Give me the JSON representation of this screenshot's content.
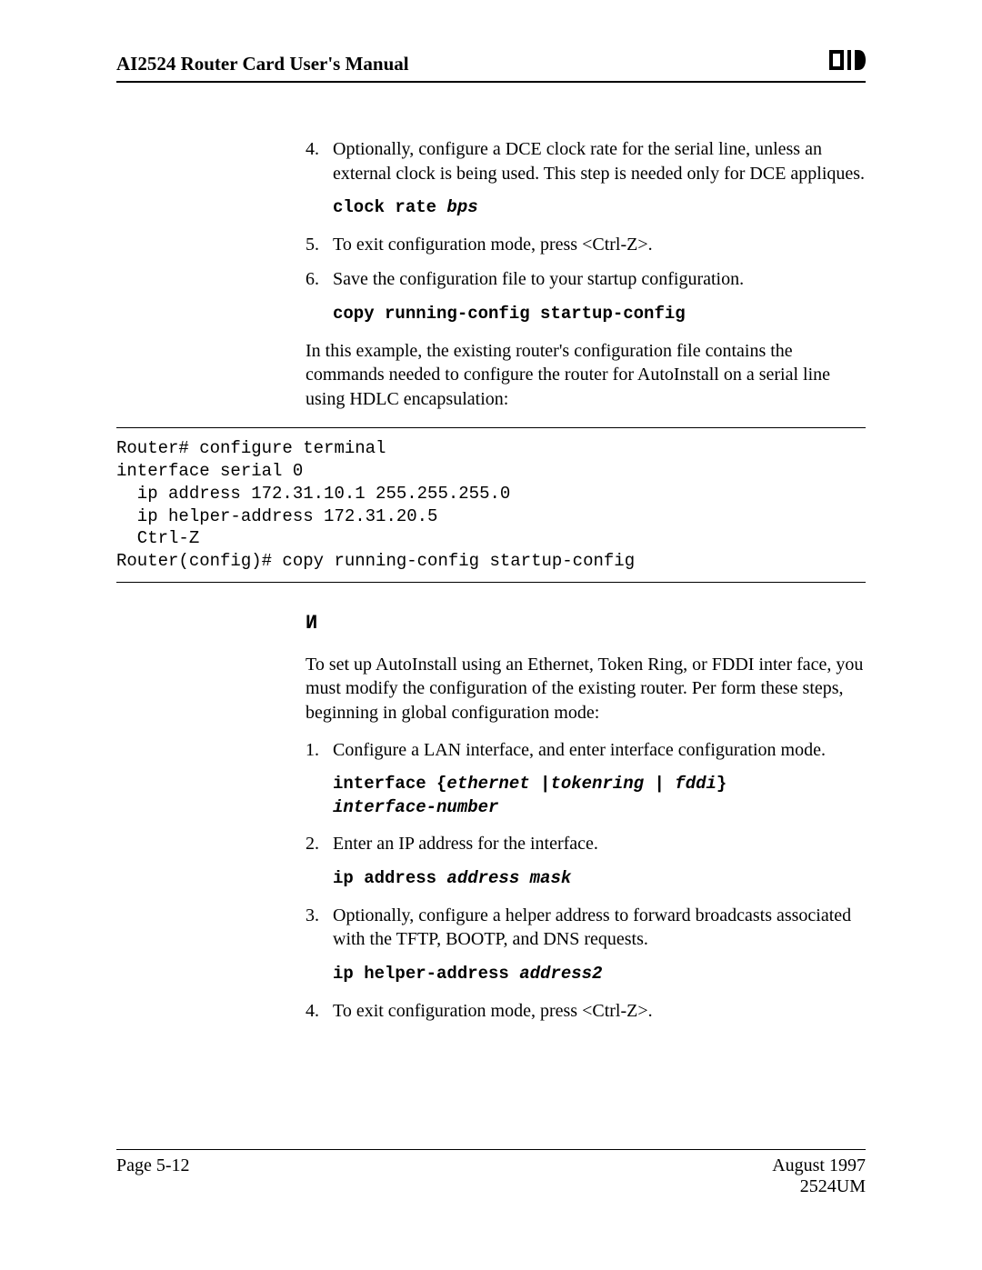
{
  "header": {
    "title": "AI2524 Router Card User's Manual"
  },
  "body": {
    "step4": {
      "num": "4.",
      "text": "Optionally, configure a DCE clock rate for the serial line, unless an external clock is being used. This step is needed only for DCE appliques."
    },
    "cmd4": {
      "fixed": "clock rate ",
      "arg": "bps"
    },
    "step5": {
      "num": "5.",
      "text": "To exit configuration mode, press <Ctrl-Z>."
    },
    "step6": {
      "num": "6.",
      "text": "Save the configuration file to your startup configuration."
    },
    "cmd6": {
      "fixed": "copy running-config startup-config"
    },
    "para1": "In this example, the existing router's configuration file contains the commands needed to configure the router for AutoInstall on a serial line using HDLC encapsulation:",
    "code": "Router# configure terminal\ninterface serial 0\n  ip address 172.31.10.1 255.255.255.0\n  ip helper-address 172.31.20.5\n  Ctrl-Z\nRouter(config)# copy running-config startup-config",
    "glyph": "И",
    "para2": "To set up AutoInstall using an Ethernet, Token Ring, or FDDI inter face, you must modify the configuration of the existing router. Per form these steps, beginning in global configuration mode:",
    "lstep1": {
      "num": "1.",
      "text": "Configure a LAN interface, and enter interface configuration mode."
    },
    "lcmd1": {
      "line1_fixed": "interface {",
      "line1_arg1": "ethernet ",
      "line1_pipe1": "|",
      "line1_arg2": "tokenring ",
      "line1_pipe2": "| ",
      "line1_arg3": "fddi",
      "line1_close": "}",
      "line2_arg": "interface-number"
    },
    "lstep2": {
      "num": "2.",
      "text": "Enter an IP address for the interface."
    },
    "lcmd2": {
      "fixed": "ip address ",
      "arg": "address mask"
    },
    "lstep3": {
      "num": "3.",
      "text": "Optionally, configure a helper address to forward broadcasts associated with the TFTP, BOOTP, and DNS requests."
    },
    "lcmd3": {
      "fixed": "ip helper-address ",
      "arg": "address2"
    },
    "lstep4": {
      "num": "4.",
      "text": "To exit configuration mode, press <Ctrl-Z>."
    }
  },
  "footer": {
    "left": "Page 5-12",
    "right1": "August 1997",
    "right2": "2524UM"
  }
}
